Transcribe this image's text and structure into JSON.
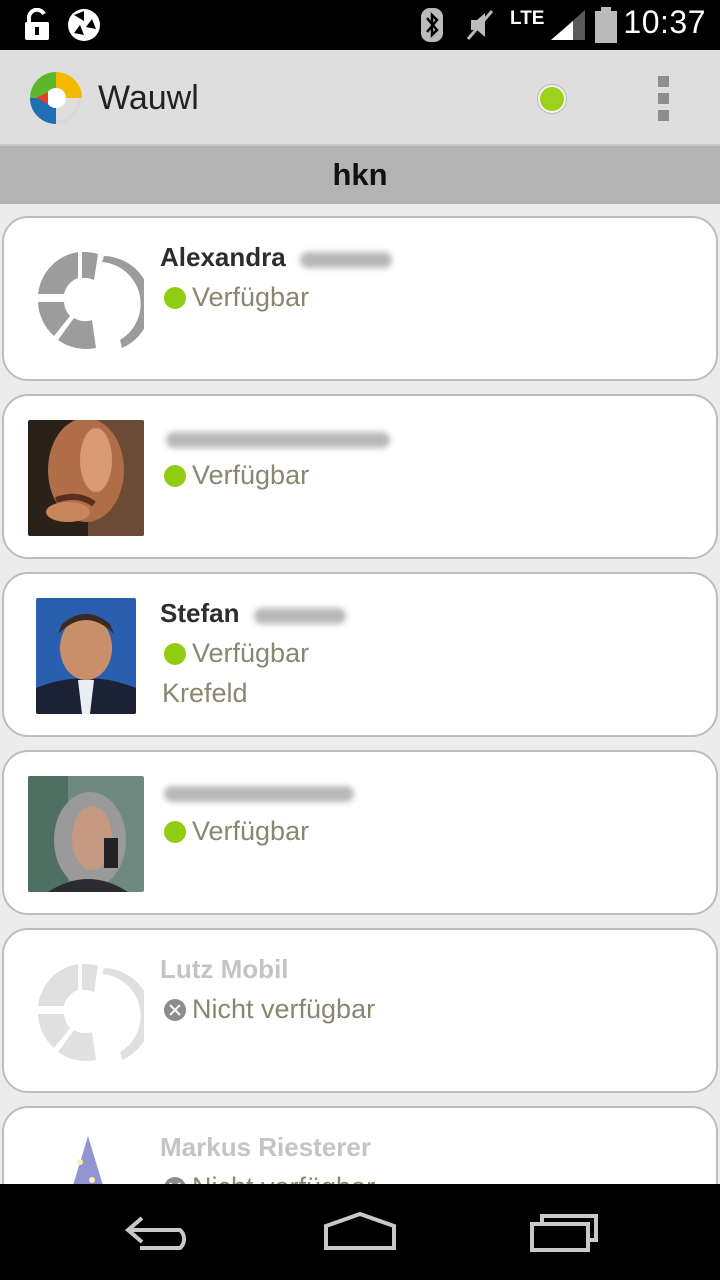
{
  "status_bar": {
    "time": "10:37",
    "network_label": "LTE",
    "icons": [
      "lock-icon",
      "sync-icon",
      "bluetooth-icon",
      "mute-icon",
      "signal-icon",
      "battery-icon"
    ]
  },
  "app_bar": {
    "title": "Wauwl",
    "presence_color": "#9dd21a",
    "menu_icon": "overflow-menu-icon"
  },
  "group": {
    "title": "hkn"
  },
  "contacts": [
    {
      "name": "Alexandra",
      "status": "Verfügbar",
      "location": "",
      "online": true,
      "avatar": "default-avatar"
    },
    {
      "name": "",
      "status": "Verfügbar",
      "location": "",
      "online": true,
      "avatar": "photo"
    },
    {
      "name": "Stefan",
      "status": "Verfügbar",
      "location": "Krefeld",
      "online": true,
      "avatar": "photo"
    },
    {
      "name": "",
      "status": "Verfügbar",
      "location": "",
      "online": true,
      "avatar": "photo"
    },
    {
      "name": "Lutz Mobil",
      "status": "Nicht verfügbar",
      "location": "",
      "online": false,
      "avatar": "default-avatar"
    },
    {
      "name": "Markus Riesterer",
      "status": "Nicht verfügbar",
      "location": "",
      "online": false,
      "avatar": "wizard"
    }
  ],
  "colors": {
    "available": "#8fcc12",
    "unavailable": "#8c8c8c",
    "status_text": "#8a8670",
    "logo_yellow": "#f5b800",
    "logo_green": "#5cb82a",
    "logo_blue": "#1f6fb4"
  },
  "nav_bar": {
    "icons": [
      "back-icon",
      "home-icon",
      "recents-icon"
    ]
  }
}
